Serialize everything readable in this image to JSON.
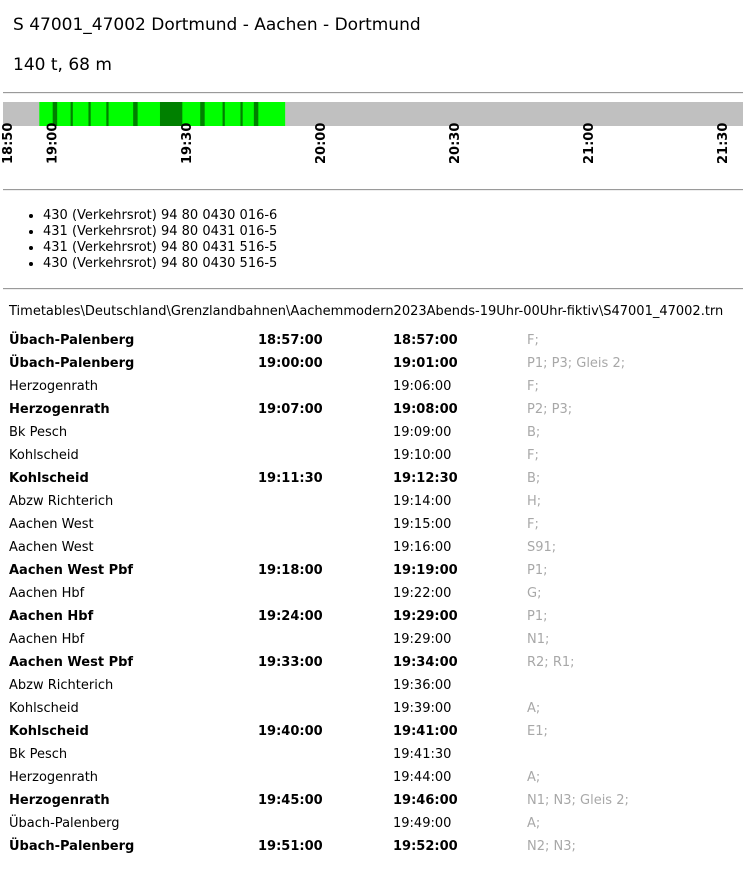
{
  "train": {
    "title": "S 47001_47002 Dortmund - Aachen - Dortmund",
    "specs": "140 t, 68 m"
  },
  "timeline": {
    "track_color": "#c0c0c0",
    "occupied_color": "#00ff00",
    "stop_color": "#008000",
    "range_start_min": 1130,
    "range_end_min": 1295,
    "occupied_start_min": 1137,
    "occupied_end_min": 1192,
    "tick_labels": [
      "18:50",
      "19:00",
      "19:30",
      "20:00",
      "20:30",
      "21:00",
      "21:30"
    ],
    "tick_minutes": [
      1130,
      1140,
      1170,
      1200,
      1230,
      1260,
      1290
    ],
    "stop_marks": [
      {
        "from": 1140,
        "to": 1141
      },
      {
        "from": 1144,
        "to": 1144.5
      },
      {
        "from": 1148,
        "to": 1148.5
      },
      {
        "from": 1152,
        "to": 1152.5
      },
      {
        "from": 1158,
        "to": 1159
      },
      {
        "from": 1164,
        "to": 1169
      },
      {
        "from": 1173,
        "to": 1174
      },
      {
        "from": 1178,
        "to": 1178.5
      },
      {
        "from": 1182,
        "to": 1182.5
      },
      {
        "from": 1185,
        "to": 1186
      }
    ]
  },
  "vehicles": [
    "430 (Verkehrsrot) 94 80 0430 016-6",
    "431 (Verkehrsrot) 94 80 0431 016-5",
    "431 (Verkehrsrot) 94 80 0431 516-5",
    "430 (Verkehrsrot) 94 80 0430 516-5"
  ],
  "timetable_path": "Timetables\\Deutschland\\Grenzlandbahnen\\Aachemmodern2023Abends-19Uhr-00Uhr-fiktiv\\S47001_47002.trn",
  "stops": [
    {
      "name": "Übach-Palenberg",
      "arrival": "18:57:00",
      "departure": "18:57:00",
      "info": "F;",
      "bold": true
    },
    {
      "name": "Übach-Palenberg",
      "arrival": "19:00:00",
      "departure": "19:01:00",
      "info": "P1; P3; Gleis 2;",
      "bold": true
    },
    {
      "name": "Herzogenrath",
      "arrival": "",
      "departure": "19:06:00",
      "info": "F;",
      "bold": false
    },
    {
      "name": "Herzogenrath",
      "arrival": "19:07:00",
      "departure": "19:08:00",
      "info": "P2; P3;",
      "bold": true
    },
    {
      "name": "Bk Pesch",
      "arrival": "",
      "departure": "19:09:00",
      "info": "B;",
      "bold": false
    },
    {
      "name": "Kohlscheid",
      "arrival": "",
      "departure": "19:10:00",
      "info": "F;",
      "bold": false
    },
    {
      "name": "Kohlscheid",
      "arrival": "19:11:30",
      "departure": "19:12:30",
      "info": "B;",
      "bold": true
    },
    {
      "name": "Abzw Richterich",
      "arrival": "",
      "departure": "19:14:00",
      "info": "H;",
      "bold": false
    },
    {
      "name": "Aachen West",
      "arrival": "",
      "departure": "19:15:00",
      "info": "F;",
      "bold": false
    },
    {
      "name": "Aachen West",
      "arrival": "",
      "departure": "19:16:00",
      "info": "S91;",
      "bold": false
    },
    {
      "name": "Aachen West Pbf",
      "arrival": "19:18:00",
      "departure": "19:19:00",
      "info": "P1;",
      "bold": true
    },
    {
      "name": "Aachen Hbf",
      "arrival": "",
      "departure": "19:22:00",
      "info": "G;",
      "bold": false
    },
    {
      "name": "Aachen Hbf",
      "arrival": "19:24:00",
      "departure": "19:29:00",
      "info": "P1;",
      "bold": true
    },
    {
      "name": "Aachen Hbf",
      "arrival": "",
      "departure": "19:29:00",
      "info": "N1;",
      "bold": false
    },
    {
      "name": "Aachen West Pbf",
      "arrival": "19:33:00",
      "departure": "19:34:00",
      "info": "R2; R1;",
      "bold": true
    },
    {
      "name": "Abzw Richterich",
      "arrival": "",
      "departure": "19:36:00",
      "info": "",
      "bold": false
    },
    {
      "name": "Kohlscheid",
      "arrival": "",
      "departure": "19:39:00",
      "info": "A;",
      "bold": false
    },
    {
      "name": "Kohlscheid",
      "arrival": "19:40:00",
      "departure": "19:41:00",
      "info": "E1;",
      "bold": true
    },
    {
      "name": "Bk Pesch",
      "arrival": "",
      "departure": "19:41:30",
      "info": "",
      "bold": false
    },
    {
      "name": "Herzogenrath",
      "arrival": "",
      "departure": "19:44:00",
      "info": "A;",
      "bold": false
    },
    {
      "name": "Herzogenrath",
      "arrival": "19:45:00",
      "departure": "19:46:00",
      "info": "N1; N3; Gleis 2;",
      "bold": true
    },
    {
      "name": "Übach-Palenberg",
      "arrival": "",
      "departure": "19:49:00",
      "info": "A;",
      "bold": false
    },
    {
      "name": "Übach-Palenberg",
      "arrival": "19:51:00",
      "departure": "19:52:00",
      "info": "N2; N3;",
      "bold": true
    }
  ]
}
